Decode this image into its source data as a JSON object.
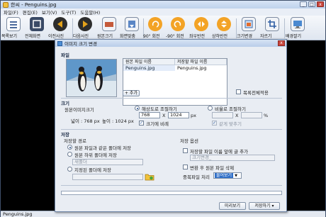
{
  "window": {
    "title": "한씨 - Penguins.jpg",
    "controls": [
      "_",
      "□",
      "x"
    ]
  },
  "menu": [
    "파일(F)",
    "편집(E)",
    "보기(V)",
    "도구(T)",
    "도움말(H)"
  ],
  "toolbar": {
    "items": [
      {
        "label": "목록보기",
        "icon": "list-view-icon"
      },
      {
        "label": "전체화면",
        "icon": "fullscreen-icon"
      },
      {
        "label": "이전사진",
        "icon": "previous-icon"
      },
      {
        "label": "다음사진",
        "icon": "next-icon"
      },
      {
        "label": "원본크기",
        "icon": "original-size-icon"
      },
      {
        "label": "화면맞춤",
        "icon": "fit-screen-icon"
      },
      {
        "label": "90° 회전",
        "icon": "rotate-right-icon"
      },
      {
        "label": "-90° 회전",
        "icon": "rotate-left-icon"
      },
      {
        "label": "좌우반전",
        "icon": "flip-horizontal-icon"
      },
      {
        "label": "상하반전",
        "icon": "flip-vertical-icon"
      },
      {
        "label": "크기변경",
        "icon": "resize-icon"
      },
      {
        "label": "자르기",
        "icon": "crop-icon"
      },
      {
        "label": "배경깔기",
        "icon": "wallpaper-icon"
      }
    ]
  },
  "status": {
    "filename": "Penguins.jpg"
  },
  "dialog": {
    "title": "이미지 크기 변경",
    "close": "x",
    "file_section": "파일",
    "list_headers": [
      "원본 파일 이름",
      "저장할 파일 이름"
    ],
    "files": [
      {
        "source": "Penguins.jpg",
        "target": "Penguins.jpg"
      }
    ],
    "add_button": "+ 추가",
    "apply_all_label": "목록전체적용",
    "size_section": "크기",
    "original_size_label": "원본이미지크기",
    "width_label": "넓이 : 768 px",
    "height_label": "높이 : 1024 px",
    "resolution_label": "해상도로 조절하기",
    "res_width": "768",
    "res_x": "X",
    "res_height": "1024",
    "px": "px",
    "keep_ratio_label": "크기에 비례",
    "ratio_label": "비율로 조절하기",
    "ratio_x": "X",
    "percent": "%",
    "same_ratio_label": "같게 맞추기",
    "save_section": "저장",
    "save_path_label": "저장할 경로",
    "save_options_label": "저장 옵션",
    "opt_same_folder": "원본 파일과 같은 폴더에 저장",
    "opt_subfolder": "원본 하위 폴더에 저장",
    "subfolder_placeholder": "새폴더",
    "opt_custom": "지정된 폴더에 저장",
    "add_text_label": "저장할 파일 이름 앞에 글 추가",
    "add_text_placeholder": "크기변경_",
    "delete_original_label": "변환 후 원본 파일 삭제",
    "duplicate_label": "중복파일 처리",
    "duplicate_value": "물어보기",
    "progress": 0,
    "preview_button": "미리보기",
    "save_button": "저장하기"
  }
}
